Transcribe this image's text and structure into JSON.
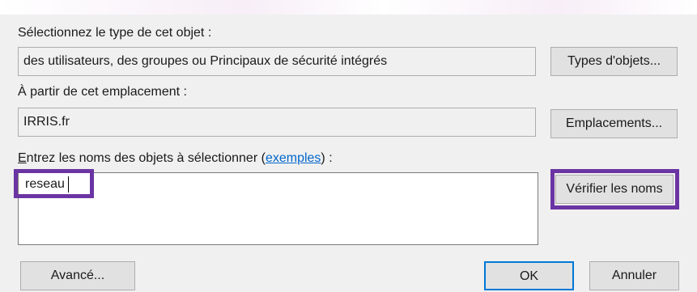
{
  "dialog": {
    "object_type_label": "Sélectionnez le type de cet objet :",
    "object_type_value": "des utilisateurs, des groupes ou Principaux de sécurité intégrés",
    "object_types_button": "Types d'objets...",
    "location_label": "À partir de cet emplacement :",
    "location_value": "IRRIS.fr",
    "locations_button": "Emplacements...",
    "names_label_prefix_accel": "E",
    "names_label_prefix_rest": "ntrez les noms des objets à sélectionner (",
    "names_label_link": "exemples",
    "names_label_suffix": ") :",
    "names_value": "reseau",
    "check_names_button": "Vérifier les noms",
    "advanced_button": "Avancé...",
    "ok_button": "OK",
    "cancel_button": "Annuler"
  },
  "colors": {
    "highlight": "#6b34a3",
    "dialog_bg": "#f0f0f0",
    "link": "#0066cc"
  }
}
